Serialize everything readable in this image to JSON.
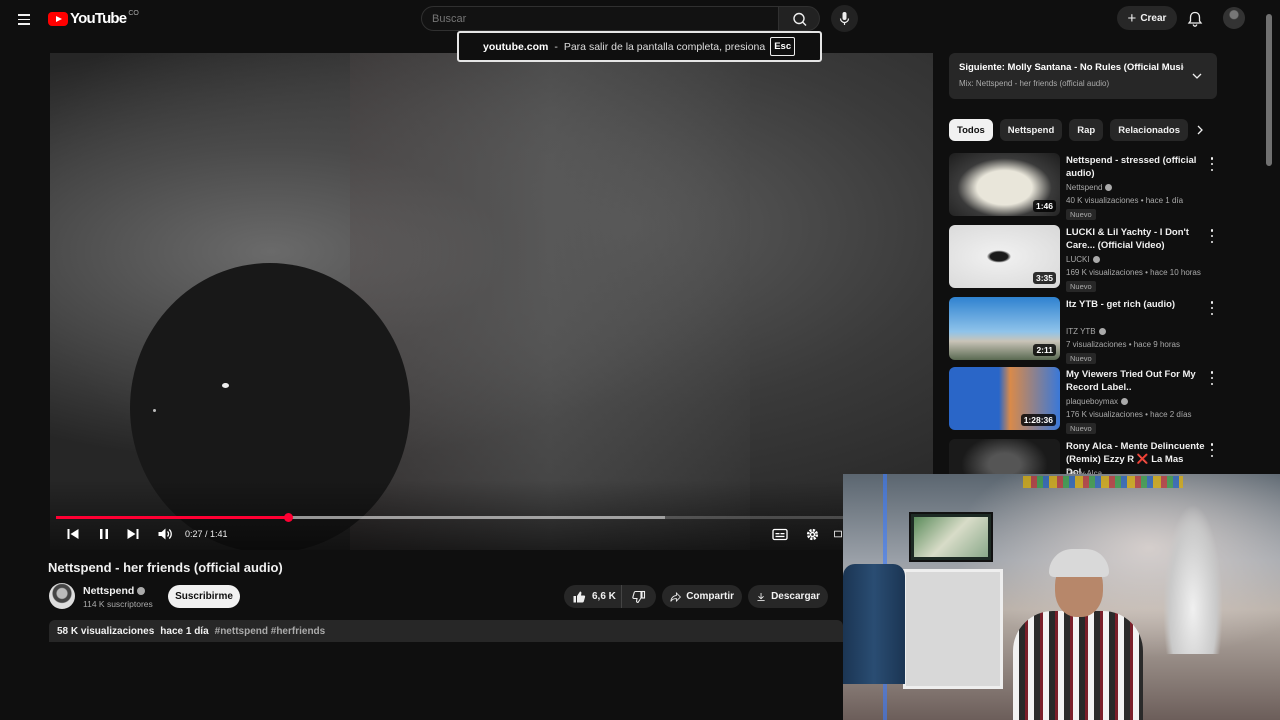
{
  "header": {
    "logo_text": "YouTube",
    "logo_suffix": "CO",
    "search_placeholder": "Buscar",
    "create_label": "Crear"
  },
  "fullscreen_toast": {
    "domain": "youtube.com",
    "separator": "-",
    "message": "Para salir de la pantalla completa, presiona",
    "key": "Esc"
  },
  "player": {
    "current_time": "0:27",
    "duration": "1:41",
    "time_display": "0:27 / 1:41",
    "progress": 0.267,
    "buffered": 0.7,
    "accent": "#ff0033"
  },
  "video": {
    "title": "Nettspend - her friends (official audio)",
    "channel": "Nettspend",
    "subscribers": "114 K suscriptores",
    "subscribe_label": "Suscribirme",
    "likes": "6,6 K",
    "share_label": "Compartir",
    "download_label": "Descargar",
    "views": "58 K visualizaciones",
    "published": "hace 1 día",
    "hashtags": "#nettspend #herfriends"
  },
  "up_next": {
    "title": "Siguiente: Molly Santana - No Rules (Official Music ...",
    "subtitle": "Mix: Nettspend - her friends (official audio)"
  },
  "chips": [
    "Todos",
    "Nettspend",
    "Rap",
    "Relacionados"
  ],
  "recommendations": [
    {
      "title": "Nettspend - stressed (official audio)",
      "channel": "Nettspend",
      "meta": "40 K visualizaciones • hace 1 día",
      "badge": "Nuevo",
      "duration": "1:46",
      "thumb_colors": [
        "#e8e8e0",
        "#2a2a2a"
      ]
    },
    {
      "title": "LUCKI & Lil Yachty - I Don't Care... (Official Video)",
      "channel": "LUCKI",
      "meta": "169 K visualizaciones • hace 10 horas",
      "badge": "Nuevo",
      "duration": "3:35",
      "thumb_colors": [
        "#f2f2f2",
        "#1a1a1a"
      ]
    },
    {
      "title": "Itz YTB - get rich (audio)",
      "channel": "ITZ YTB",
      "meta": "7 visualizaciones • hace 9 horas",
      "badge": "Nuevo",
      "duration": "2:11",
      "thumb_colors": [
        "#4a9ad8",
        "#9ac6e8"
      ]
    },
    {
      "title": "My Viewers Tried Out For My Record Label..",
      "channel": "plaqueboymax",
      "meta": "176 K visualizaciones • hace 2 días",
      "badge": "Nuevo",
      "duration": "1:28:36",
      "thumb_colors": [
        "#2f6fd8",
        "#e8a060"
      ]
    },
    {
      "title": "Rony Alca - Mente Delincuente (Remix) Ezzy R ❌ La Mas Dol...",
      "channel": "Rony Alca",
      "meta": "",
      "badge": "",
      "duration": "",
      "thumb_colors": [
        "#1a1a1a",
        "#444"
      ]
    }
  ]
}
